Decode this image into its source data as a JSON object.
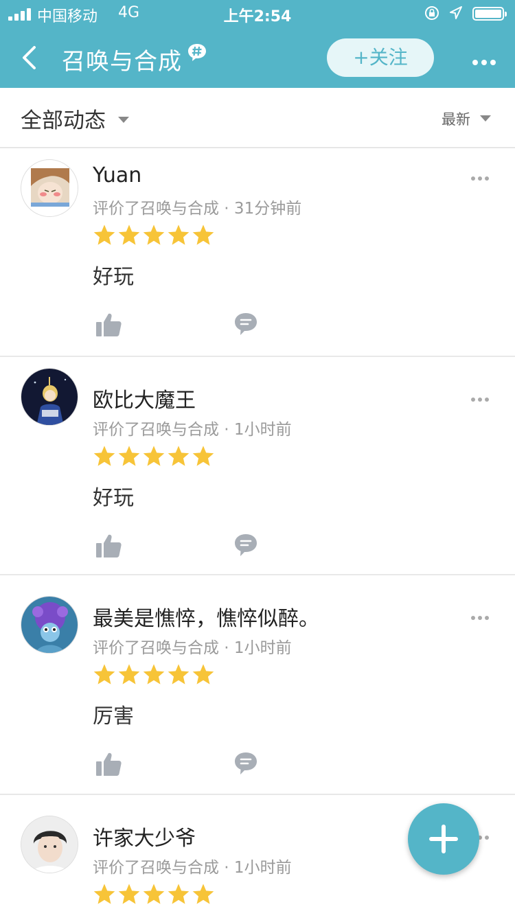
{
  "status_bar": {
    "carrier": "中国移动",
    "network": "4G",
    "time": "上午2:54"
  },
  "nav": {
    "title": "召唤与合成",
    "follow_label": "+关注"
  },
  "filter": {
    "scope_label": "全部动态",
    "sort_label": "最新"
  },
  "posts": [
    {
      "username": "Yuan",
      "meta": "评价了召唤与合成 · 31分钟前",
      "rating": 5,
      "content": "好玩"
    },
    {
      "username": "欧比大魔王",
      "meta": "评价了召唤与合成 · 1小时前",
      "rating": 5,
      "content": "好玩"
    },
    {
      "username": "最美是憔悴，憔悴似醉。",
      "meta": "评价了召唤与合成 · 1小时前",
      "rating": 5,
      "content": "厉害"
    },
    {
      "username": "许家大少爷",
      "meta": "评价了召唤与合成 · 1小时前",
      "rating": 5,
      "content": ""
    }
  ],
  "colors": {
    "brand": "#54b5c8",
    "star": "#f7c438"
  },
  "icons": {
    "back": "chevron-left-icon",
    "topic": "hashtag-bubble-icon",
    "more": "more-dots-icon",
    "like": "thumbs-up-icon",
    "comment": "comment-bubble-icon",
    "fab": "plus-icon"
  }
}
